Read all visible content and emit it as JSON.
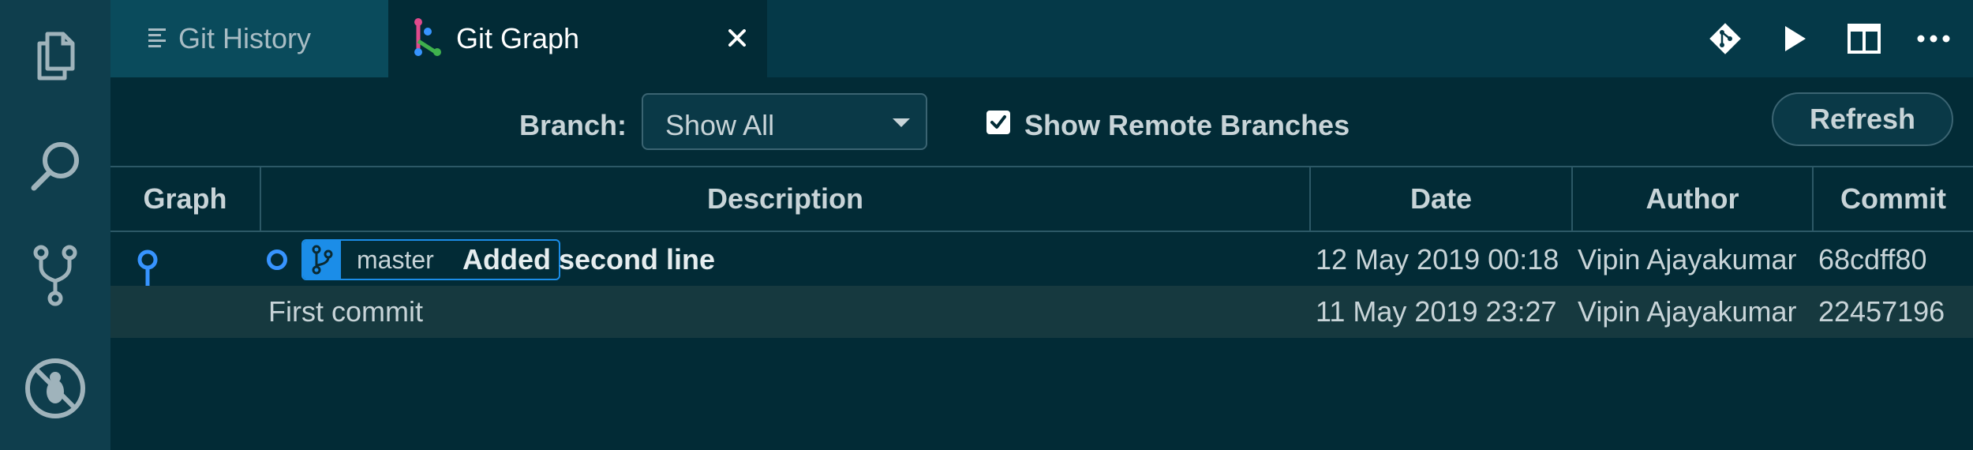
{
  "activity_bar": {
    "items": [
      {
        "name": "explorer-icon"
      },
      {
        "name": "search-icon"
      },
      {
        "name": "source-control-icon"
      },
      {
        "name": "debug-icon"
      }
    ]
  },
  "tabs": [
    {
      "label": "Git History",
      "icon": "list-icon",
      "active": false
    },
    {
      "label": "Git Graph",
      "icon": "git-graph-icon",
      "active": true
    }
  ],
  "top_actions": [
    "git-icon",
    "run-icon",
    "split-editor-icon",
    "more-actions-icon"
  ],
  "controls": {
    "branch_label": "Branch:",
    "branch_value": "Show All",
    "show_remote_label": "Show Remote Branches",
    "show_remote_checked": true,
    "refresh_label": "Refresh"
  },
  "columns": [
    "Graph",
    "Description",
    "Date",
    "Author",
    "Commit"
  ],
  "commits": [
    {
      "branch": "master",
      "subject": "Added second line",
      "date": "12 May 2019 00:18",
      "author": "Vipin Ajayakumar",
      "hash": "68cdff80"
    },
    {
      "subject": "First commit",
      "date": "11 May 2019 23:27",
      "author": "Vipin Ajayakumar",
      "hash": "22457196"
    }
  ],
  "colors": {
    "background": "#022b36",
    "accent": "#1b8de8",
    "graph_line": "#3794ff"
  }
}
